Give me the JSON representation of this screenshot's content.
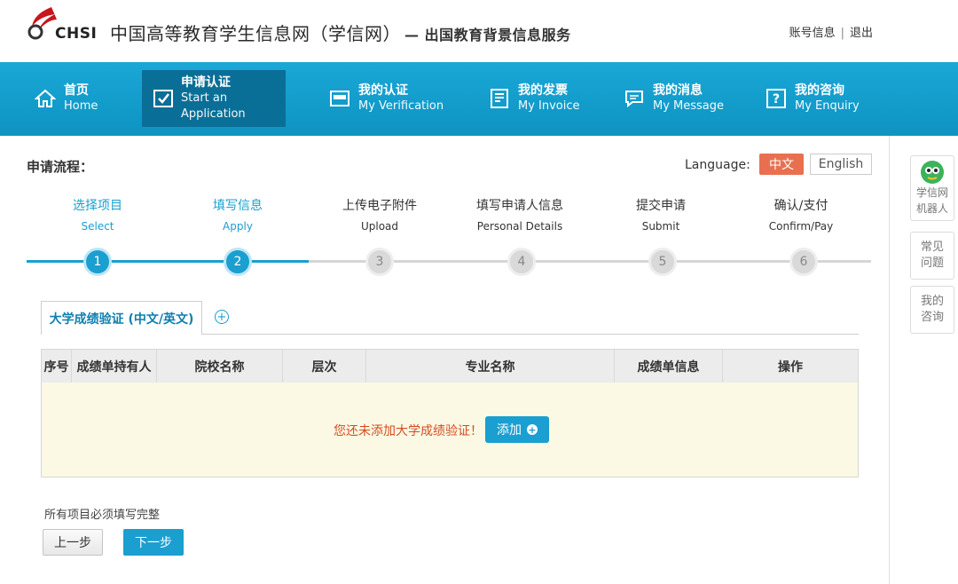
{
  "header": {
    "logo_text": "CHSI",
    "title": "中国高等教育学生信息网（学信网）",
    "subtitle": "— 出国教育背景信息服务",
    "account_info": "账号信息",
    "separator": "|",
    "logout": "退出"
  },
  "nav": {
    "items": [
      {
        "cn": "首页",
        "en": "Home",
        "icon": "home-icon"
      },
      {
        "cn": "申请认证",
        "en": "Start an Application",
        "icon": "checkbox-icon",
        "active": true
      },
      {
        "cn": "我的认证",
        "en": "My Verification",
        "icon": "certificate-icon"
      },
      {
        "cn": "我的发票",
        "en": "My Invoice",
        "icon": "invoice-icon"
      },
      {
        "cn": "我的消息",
        "en": "My Message",
        "icon": "message-icon"
      },
      {
        "cn": "我的咨询",
        "en": "My Enquiry",
        "icon": "question-icon"
      }
    ]
  },
  "flow": {
    "title": "申请流程：",
    "language_label": "Language:",
    "lang_cn": "中文",
    "lang_en": "English",
    "steps": [
      {
        "num": "1",
        "cn": "选择项目",
        "en": "Select",
        "done": true
      },
      {
        "num": "2",
        "cn": "填写信息",
        "en": "Apply",
        "done": true
      },
      {
        "num": "3",
        "cn": "上传电子附件",
        "en": "Upload",
        "done": false
      },
      {
        "num": "4",
        "cn": "填写申请人信息",
        "en": "Personal Details",
        "done": false
      },
      {
        "num": "5",
        "cn": "提交申请",
        "en": "Submit",
        "done": false
      },
      {
        "num": "6",
        "cn": "确认/支付",
        "en": "Confirm/Pay",
        "done": false
      }
    ]
  },
  "tabs": {
    "active_label": "大学成绩验证 (中文/英文)",
    "add_symbol": "+"
  },
  "table": {
    "headers": [
      "序号",
      "成绩单持有人",
      "院校名称",
      "层次",
      "专业名称",
      "成绩单信息",
      "操作"
    ],
    "empty_message": "您还未添加大学成绩验证！",
    "add_button": "添加"
  },
  "footer": {
    "note": "所有项目必须填写完整",
    "prev": "上一步",
    "next": "下一步"
  },
  "side": {
    "robot_line1": "学信网",
    "robot_line2": "机器人",
    "faq_line1": "常见",
    "faq_line2": "问题",
    "ask_line1": "我的",
    "ask_line2": "咨询"
  },
  "colors": {
    "nav_blue": "#1aa8d6",
    "nav_active": "#0a6f97",
    "accent": "#1a9fd0",
    "lang_active": "#e8704f",
    "empty_text": "#d44d1e",
    "table_body": "#fbf9e4"
  }
}
